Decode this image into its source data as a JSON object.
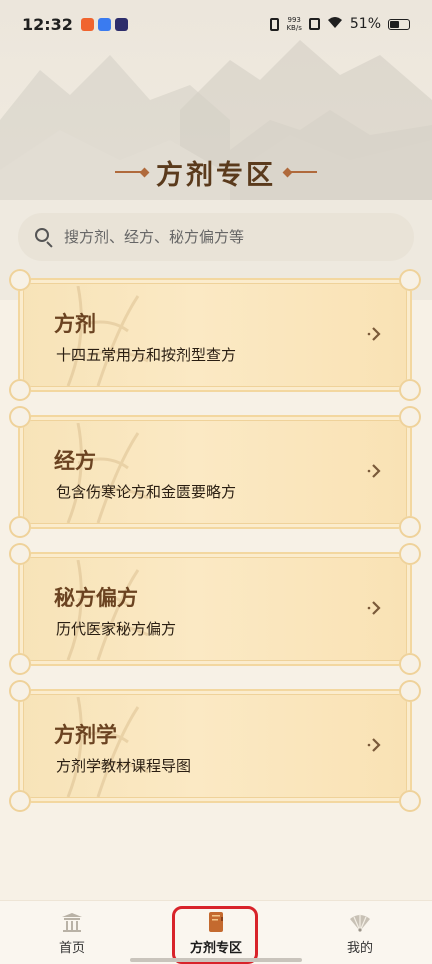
{
  "status_bar": {
    "time": "12:32",
    "net_speed_value": "993",
    "net_speed_unit": "KB/s",
    "battery_percent": "51%",
    "battery_level": 0.51
  },
  "page": {
    "title": "方剂专区"
  },
  "search": {
    "placeholder": "搜方剂、经方、秘方偏方等"
  },
  "cards": [
    {
      "title": "方剂",
      "description": "十四五常用方和按剂型查方"
    },
    {
      "title": "经方",
      "description": "包含伤寒论方和金匮要略方"
    },
    {
      "title": "秘方偏方",
      "description": "历代医家秘方偏方"
    },
    {
      "title": "方剂学",
      "description": "方剂学教材课程导图"
    }
  ],
  "bottom_nav": {
    "items": [
      {
        "label": "首页",
        "icon": "temple-icon"
      },
      {
        "label": "方剂专区",
        "icon": "book-icon",
        "active": true
      },
      {
        "label": "我的",
        "icon": "fan-icon"
      }
    ]
  },
  "colors": {
    "accent": "#b06a3c",
    "card_bg": "#fbe9c4",
    "highlight": "#d8232a"
  }
}
